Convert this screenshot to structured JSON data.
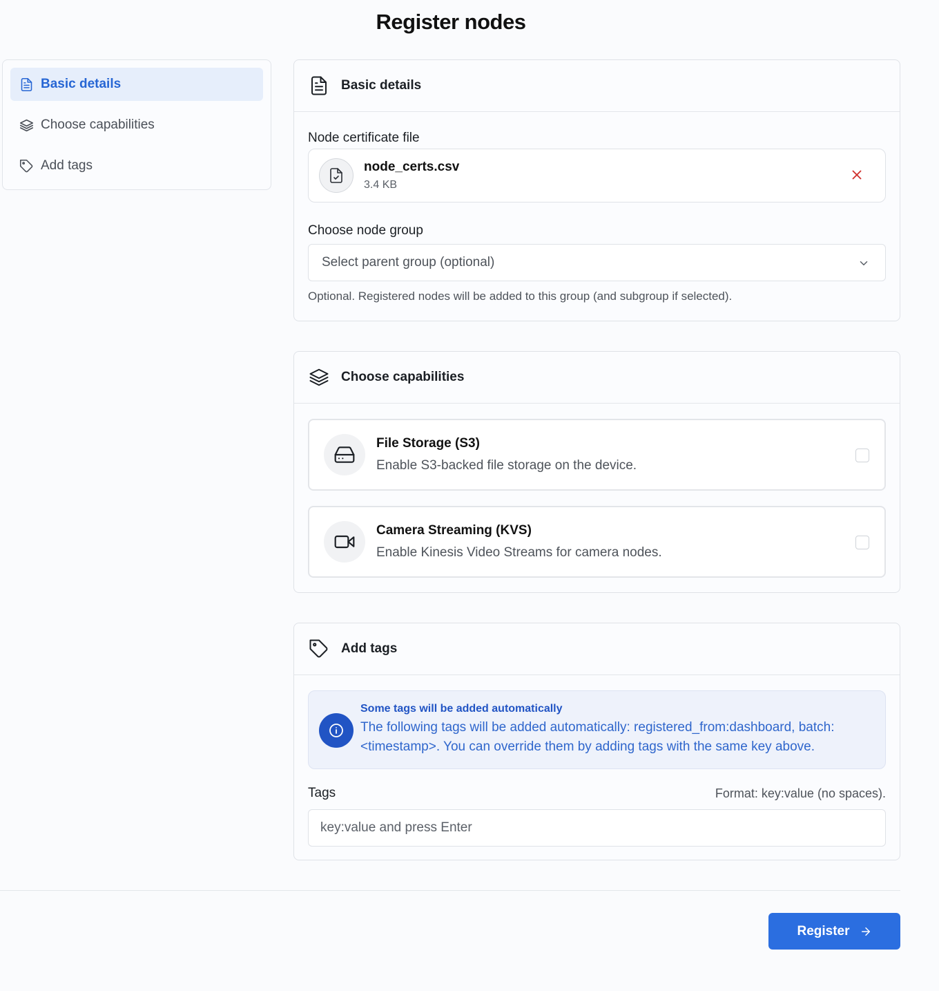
{
  "page": {
    "title": "Register nodes"
  },
  "sidebar": {
    "items": [
      {
        "label": "Basic details",
        "icon": "file-text-icon",
        "active": true
      },
      {
        "label": "Choose capabilities",
        "icon": "layers-icon",
        "active": false
      },
      {
        "label": "Add tags",
        "icon": "tag-icon",
        "active": false
      }
    ]
  },
  "basic_details": {
    "title": "Basic details",
    "cert_label": "Node certificate file",
    "file": {
      "name": "node_certs.csv",
      "size": "3.4 KB"
    },
    "group_label": "Choose node group",
    "group_placeholder": "Select parent group (optional)",
    "group_hint": "Optional. Registered nodes will be added to this group (and subgroup if selected)."
  },
  "capabilities": {
    "title": "Choose capabilities",
    "items": [
      {
        "title": "File Storage (S3)",
        "description": "Enable S3-backed file storage on the device.",
        "icon": "hard-drive-icon",
        "checked": false
      },
      {
        "title": "Camera Streaming (KVS)",
        "description": "Enable Kinesis Video Streams for camera nodes.",
        "icon": "video-icon",
        "checked": false
      }
    ]
  },
  "tags": {
    "title": "Add tags",
    "info_title": "Some tags will be added automatically",
    "info_text": "The following tags will be added automatically: registered_from:dashboard, batch:<timestamp>. You can override them by adding tags with the same key above.",
    "label": "Tags",
    "format": "Format: key:value (no spaces).",
    "placeholder": "key:value and press Enter"
  },
  "footer": {
    "register_label": "Register"
  },
  "colors": {
    "accent": "#2b6ee0",
    "active_bg": "#e6eefb",
    "info_bg": "#eef2fb",
    "info_text": "#2154c4",
    "remove": "#d0312d"
  }
}
